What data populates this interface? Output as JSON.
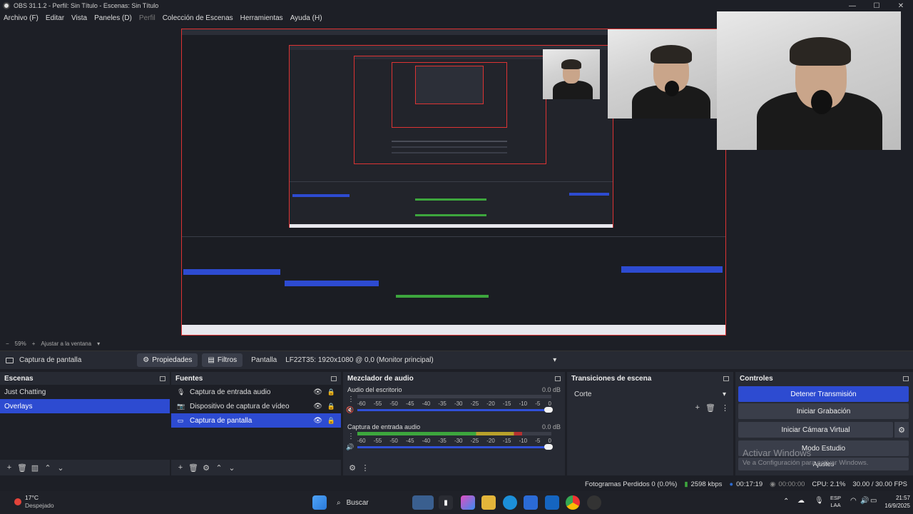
{
  "window": {
    "title": "OBS 31.1.2 - Perfil: Sin Título - Escenas: Sin Título",
    "minimize": "—",
    "maximize": "☐",
    "close": "✕"
  },
  "menu": {
    "items": [
      "Archivo (F)",
      "Editar",
      "Vista",
      "Paneles (D)",
      "Perfil",
      "Colección de Escenas",
      "Herramientas",
      "Ayuda (H)"
    ]
  },
  "preview": {
    "zoom": "59%",
    "fit_label": "Ajustar a la ventana"
  },
  "source_toolbar": {
    "source_name": "Captura de pantalla",
    "properties_label": "Propiedades",
    "filters_label": "Filtros",
    "screen_label": "Pantalla",
    "screen_value": "LF22T35: 1920x1080 @ 0,0 (Monitor principal)"
  },
  "scenes": {
    "title": "Escenas",
    "items": [
      "Just Chatting",
      "Overlays"
    ],
    "selected_index": 1
  },
  "sources": {
    "title": "Fuentes",
    "items": [
      {
        "label": "Captura de entrada audio",
        "icon": "mic-icon"
      },
      {
        "label": "Dispositivo de captura de vídeo",
        "icon": "camera-icon"
      },
      {
        "label": "Captura de pantalla",
        "icon": "monitor-icon"
      }
    ],
    "selected_index": 2
  },
  "mixer": {
    "title": "Mezclador de audio",
    "scale": [
      "-60",
      "-55",
      "-50",
      "-45",
      "-40",
      "-35",
      "-30",
      "-25",
      "-20",
      "-15",
      "-10",
      "-5",
      "0"
    ],
    "channels": [
      {
        "name": "Audio del escritorio",
        "db": "0.0 dB",
        "level": 0.0
      },
      {
        "name": "Captura de entrada audio",
        "db": "0.0 dB",
        "level": 0.85
      }
    ]
  },
  "transitions": {
    "title": "Transiciones de escena",
    "selected": "Corte"
  },
  "controls": {
    "title": "Controles",
    "stop_stream": "Detener Transmisión",
    "start_recording": "Iniciar Grabación",
    "start_virtual_cam": "Iniciar Cámara Virtual",
    "studio_mode": "Modo Estudio",
    "settings": "Ajustes"
  },
  "watermark": {
    "line1": "Activar Windows",
    "line2": "Ve a Configuración para activar Windows."
  },
  "status": {
    "dropped_frames": "Fotogramas Perdidos 0 (0.0%)",
    "bitrate": "2598 kbps",
    "stream_time": "00:17:19",
    "record_time": "00:00:00",
    "cpu": "CPU: 2.1%",
    "fps": "30.00 / 30.00 FPS"
  },
  "taskbar": {
    "weather_temp": "17°C",
    "weather_desc": "Despejado",
    "search_placeholder": "Buscar",
    "lang_top": "ESP",
    "lang_bottom": "LAA",
    "time": "21:57",
    "date": "16/9/2025"
  },
  "colors": {
    "accent": "#2d4bd1",
    "preview_border": "#dd3333",
    "meter_green": "#3da63d",
    "meter_yellow": "#b8a12b",
    "meter_red": "#b53030"
  }
}
